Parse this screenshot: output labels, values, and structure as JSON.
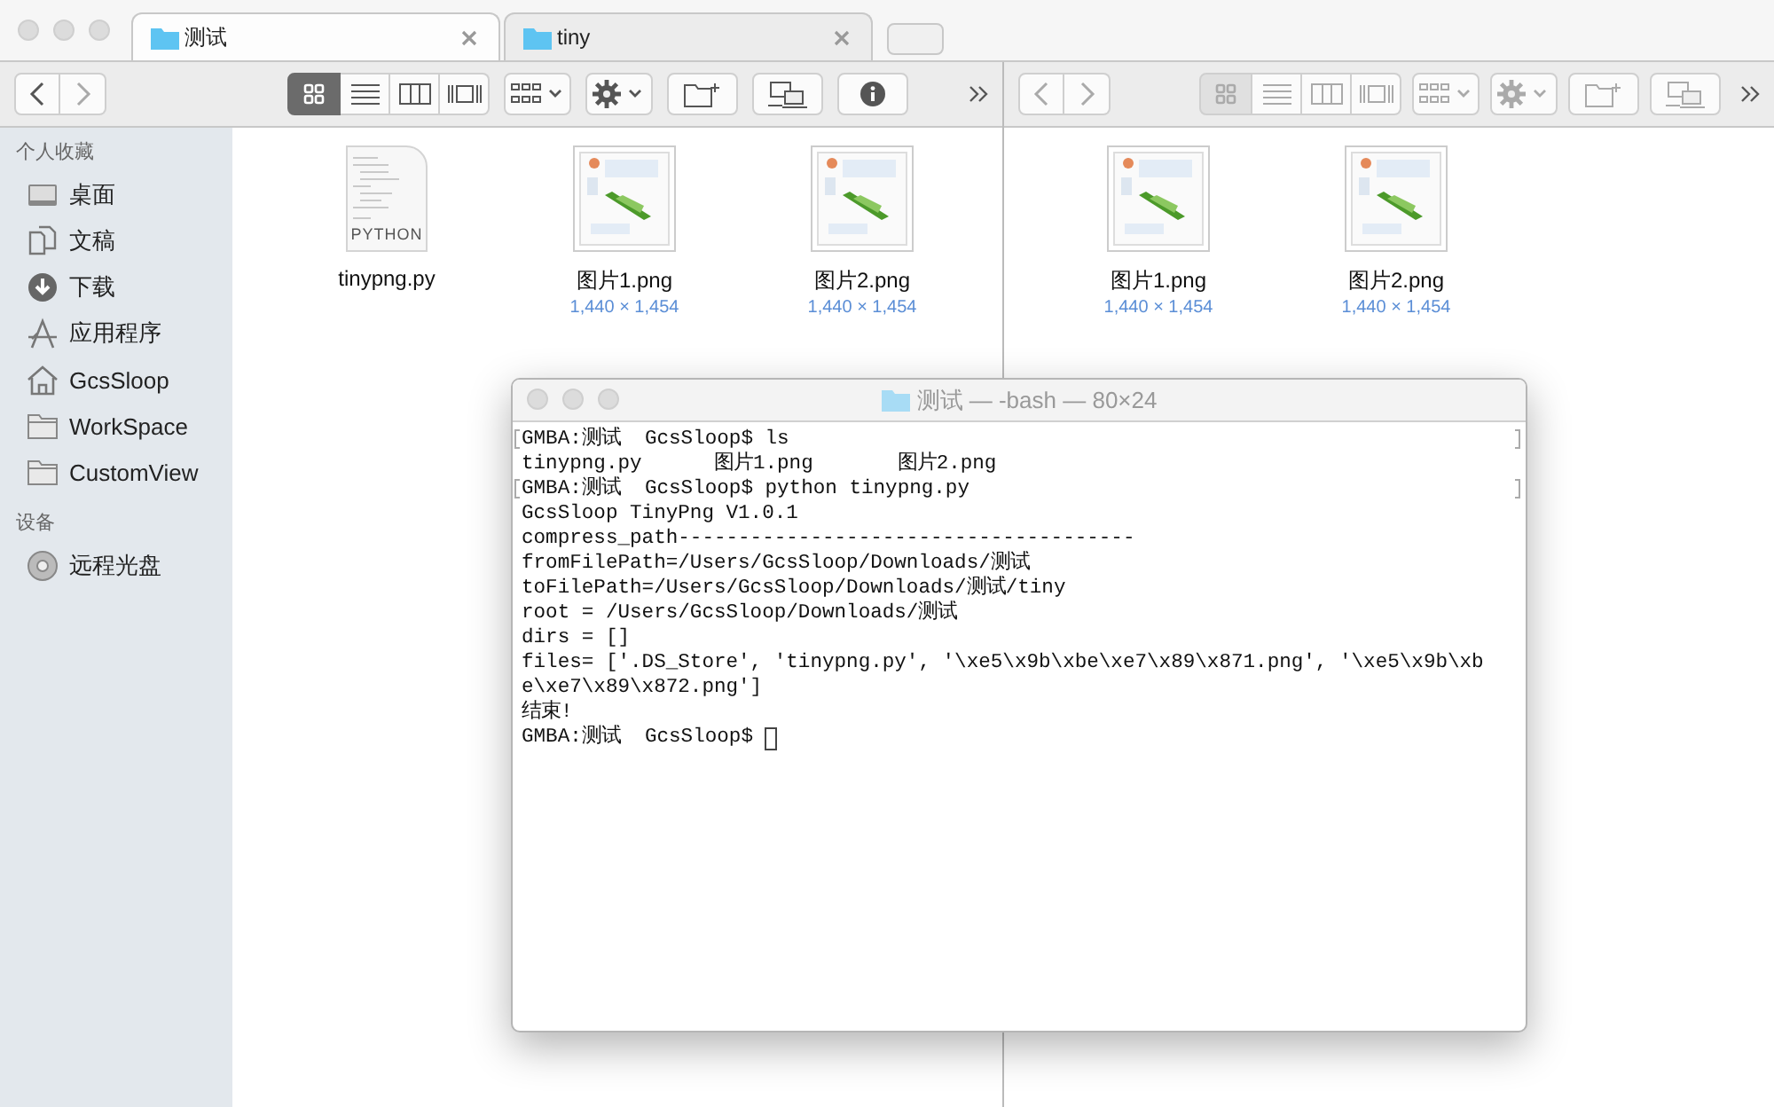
{
  "tabs": [
    {
      "label": "测试",
      "selected": true
    },
    {
      "label": "tiny",
      "selected": false
    }
  ],
  "panes": [
    {
      "active": true,
      "info_button": true,
      "views": [
        {
          "kind": "icons",
          "selected": true
        },
        {
          "kind": "list",
          "selected": false
        },
        {
          "kind": "columns",
          "selected": false
        },
        {
          "kind": "coverflow",
          "selected": false
        }
      ],
      "files": [
        {
          "kind": "python",
          "name": "tinypng.py",
          "badge": "PYTHON"
        },
        {
          "name": "图片1.png",
          "dimensions": "1,440 × 1,454"
        },
        {
          "name": "图片2.png",
          "dimensions": "1,440 × 1,454"
        }
      ]
    },
    {
      "active": false,
      "info_button": false,
      "views": [
        {
          "kind": "icons",
          "selected": true
        },
        {
          "kind": "list",
          "selected": false
        },
        {
          "kind": "columns",
          "selected": false
        },
        {
          "kind": "coverflow",
          "selected": false
        }
      ],
      "files": [
        {
          "name": "图片1.png",
          "dimensions": "1,440 × 1,454"
        },
        {
          "name": "图片2.png",
          "dimensions": "1,440 × 1,454"
        }
      ]
    }
  ],
  "sidebar": {
    "sections": [
      {
        "title": "个人收藏",
        "items": [
          {
            "kind": "desktop",
            "label": "桌面"
          },
          {
            "kind": "documents",
            "label": "文稿"
          },
          {
            "kind": "downloads",
            "label": "下载"
          },
          {
            "kind": "apps",
            "label": "应用程序"
          },
          {
            "kind": "home",
            "label": "GcsSloop"
          },
          {
            "kind": "folder",
            "label": "WorkSpace"
          },
          {
            "kind": "folder",
            "label": "CustomView"
          }
        ]
      },
      {
        "title": "设备",
        "items": [
          {
            "kind": "disc",
            "label": "远程光盘"
          }
        ]
      }
    ]
  },
  "terminal": {
    "title": "测试 — -bash — 80×24",
    "lines": [
      {
        "text": "GMBA:测试  GcsSloop$ ls",
        "marked": true
      },
      {
        "text": "tinypng.py      图片1.png       图片2.png",
        "marked": false
      },
      {
        "text": "GMBA:测试  GcsSloop$ python tinypng.py",
        "marked": true
      },
      {
        "text": "GcsSloop TinyPng V1.0.1",
        "marked": false
      },
      {
        "text": "compress_path--------------------------------------",
        "marked": false
      },
      {
        "text": "fromFilePath=/Users/GcsSloop/Downloads/测试",
        "marked": false
      },
      {
        "text": "toFilePath=/Users/GcsSloop/Downloads/测试/tiny",
        "marked": false
      },
      {
        "text": "root = /Users/GcsSloop/Downloads/测试",
        "marked": false
      },
      {
        "text": "dirs = []",
        "marked": false
      },
      {
        "text": "files= ['.DS_Store', 'tinypng.py', '\\xe5\\x9b\\xbe\\xe7\\x89\\x871.png', '\\xe5\\x9b\\xb",
        "marked": false
      },
      {
        "text": "e\\xe7\\x89\\x872.png']",
        "marked": false
      },
      {
        "text": "结束!",
        "marked": false
      },
      {
        "text": "GMBA:测试  GcsSloop$ ",
        "marked": false,
        "cursor": true
      }
    ]
  }
}
